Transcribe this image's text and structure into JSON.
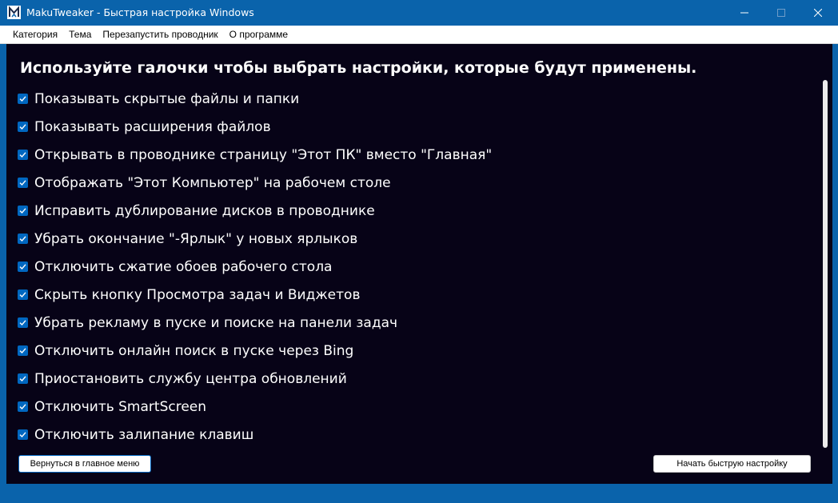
{
  "window": {
    "title": "MakuTweaker - Быстрая настройка Windows",
    "accent_color": "#0a63ab",
    "content_bg": "#070317"
  },
  "titlebar_buttons": {
    "minimize_icon": "minimize-icon",
    "maximize_icon": "maximize-icon",
    "close_icon": "close-icon"
  },
  "menu": {
    "items": [
      {
        "label": "Категория"
      },
      {
        "label": "Тема"
      },
      {
        "label": "Перезапустить проводник"
      },
      {
        "label": "О программе"
      }
    ]
  },
  "main": {
    "heading": "Используйте галочки чтобы выбрать настройки, которые будут применены.",
    "options": [
      {
        "label": "Показывать скрытые файлы и папки",
        "checked": true
      },
      {
        "label": "Показывать расширения файлов",
        "checked": true
      },
      {
        "label": "Открывать в проводнике страницу \"Этот ПК\" вместо \"Главная\"",
        "checked": true
      },
      {
        "label": "Отображать \"Этот Компьютер\" на рабочем столе",
        "checked": true
      },
      {
        "label": "Исправить дублирование дисков в проводнике",
        "checked": true
      },
      {
        "label": "Убрать окончание \"-Ярлык\" у новых ярлыков",
        "checked": true
      },
      {
        "label": "Отключить сжатие обоев рабочего стола",
        "checked": true
      },
      {
        "label": "Скрыть кнопку Просмотра задач и Виджетов",
        "checked": true
      },
      {
        "label": "Убрать рекламу в пуске и поиске на панели задач",
        "checked": true
      },
      {
        "label": "Отключить онлайн поиск в пуске через Bing",
        "checked": true
      },
      {
        "label": "Приостановить службу центра обновлений",
        "checked": true
      },
      {
        "label": "Отключить SmartScreen",
        "checked": true
      },
      {
        "label": "Отключить залипание клавиш",
        "checked": true
      }
    ],
    "checkbox_color": "#0067c0"
  },
  "footer": {
    "back_label": "Вернуться в главное меню",
    "start_label": "Начать быструю настройку"
  }
}
